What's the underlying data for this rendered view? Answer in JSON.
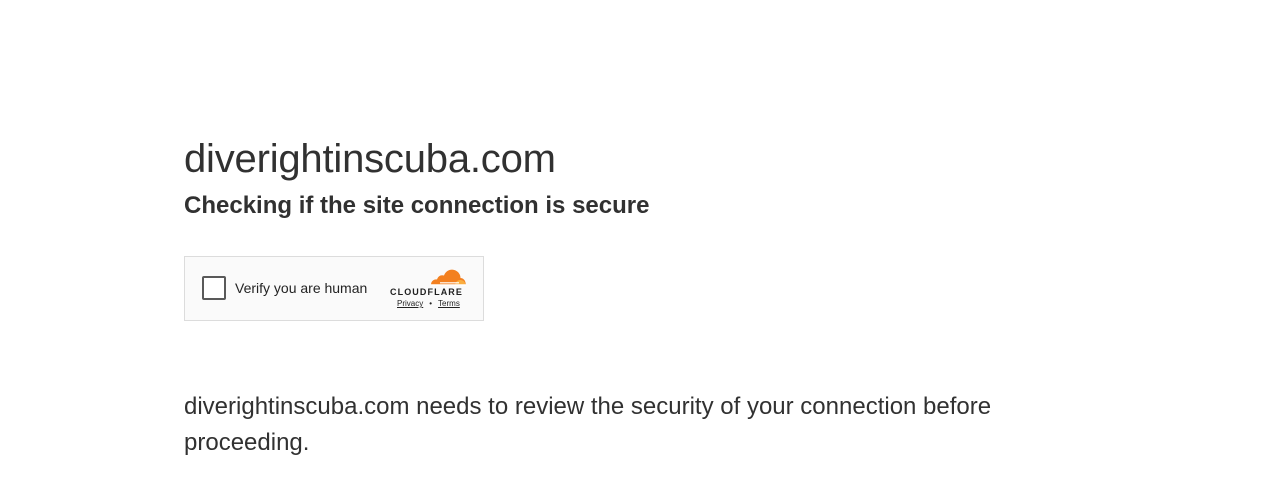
{
  "page": {
    "site_name": "diverightinscuba.com",
    "subtitle": "Checking if the site connection is secure",
    "explanation": "diverightinscuba.com needs to review the security of your connection before proceeding."
  },
  "widget": {
    "checkbox_checked": false,
    "label": "Verify you are human",
    "brand": "CLOUDFLARE",
    "privacy_link": "Privacy",
    "separator": "•",
    "terms_link": "Terms",
    "brand_icon": "cloudflare-cloud-icon"
  },
  "colors": {
    "text": "#313131",
    "widget_border": "#dcdcdc",
    "widget_background": "#fafafa",
    "cloudflare_orange": "#f38020",
    "cloudflare_light_orange": "#faae40"
  }
}
